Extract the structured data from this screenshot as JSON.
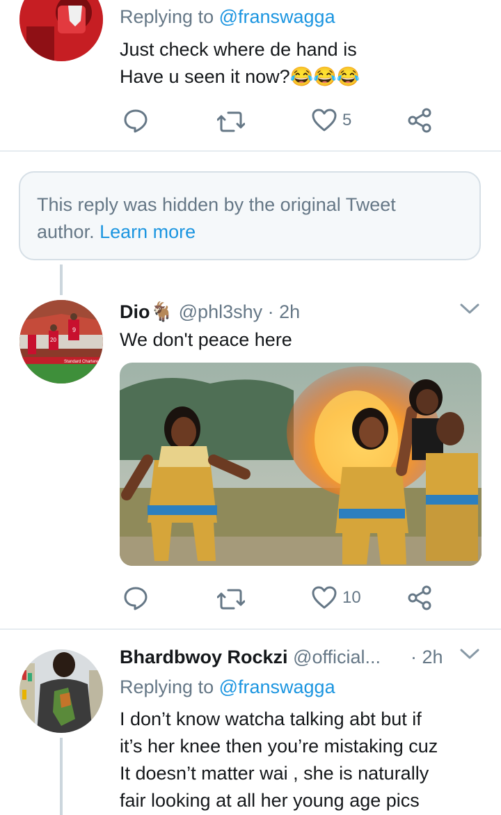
{
  "tweet1": {
    "replying_prefix": "Replying to ",
    "replying_handle": "@franswagga",
    "line1": "Just check where de hand is",
    "line2": "Have u seen it now?",
    "emoji": "😂😂😂",
    "likes": "5"
  },
  "hidden_notice": {
    "text_line1": "This reply was hidden by the original Tweet",
    "text_line2": "author.",
    "learn_more": "Learn more"
  },
  "tweet2": {
    "name": "Dio",
    "name_emoji": "🐐",
    "handle": "@phl3shy",
    "time": "· 2h",
    "text": "We don't peace here",
    "likes": "10",
    "avatar_jersey_a": "20",
    "avatar_jersey_b": "9",
    "avatar_banner": "Standard Chartered"
  },
  "tweet3": {
    "name": "Bhardbwoy Rockzi",
    "handle": "@official...",
    "time": "· 2h",
    "replying_prefix": "Replying to ",
    "replying_handle": "@franswagga",
    "line1": "I don’t know watcha talking abt but if",
    "line2": "it’s her knee then you’re mistaking cuz",
    "line3": "It doesn’t matter wai , she is naturally",
    "line4": "fair looking at all her young age pics"
  },
  "colors": {
    "accent": "#1b95e0",
    "secondary_text": "#657786",
    "divider": "#e6ecf0"
  },
  "icons": [
    "reply-icon",
    "retweet-icon",
    "like-icon",
    "share-icon",
    "chevron-down-icon"
  ]
}
